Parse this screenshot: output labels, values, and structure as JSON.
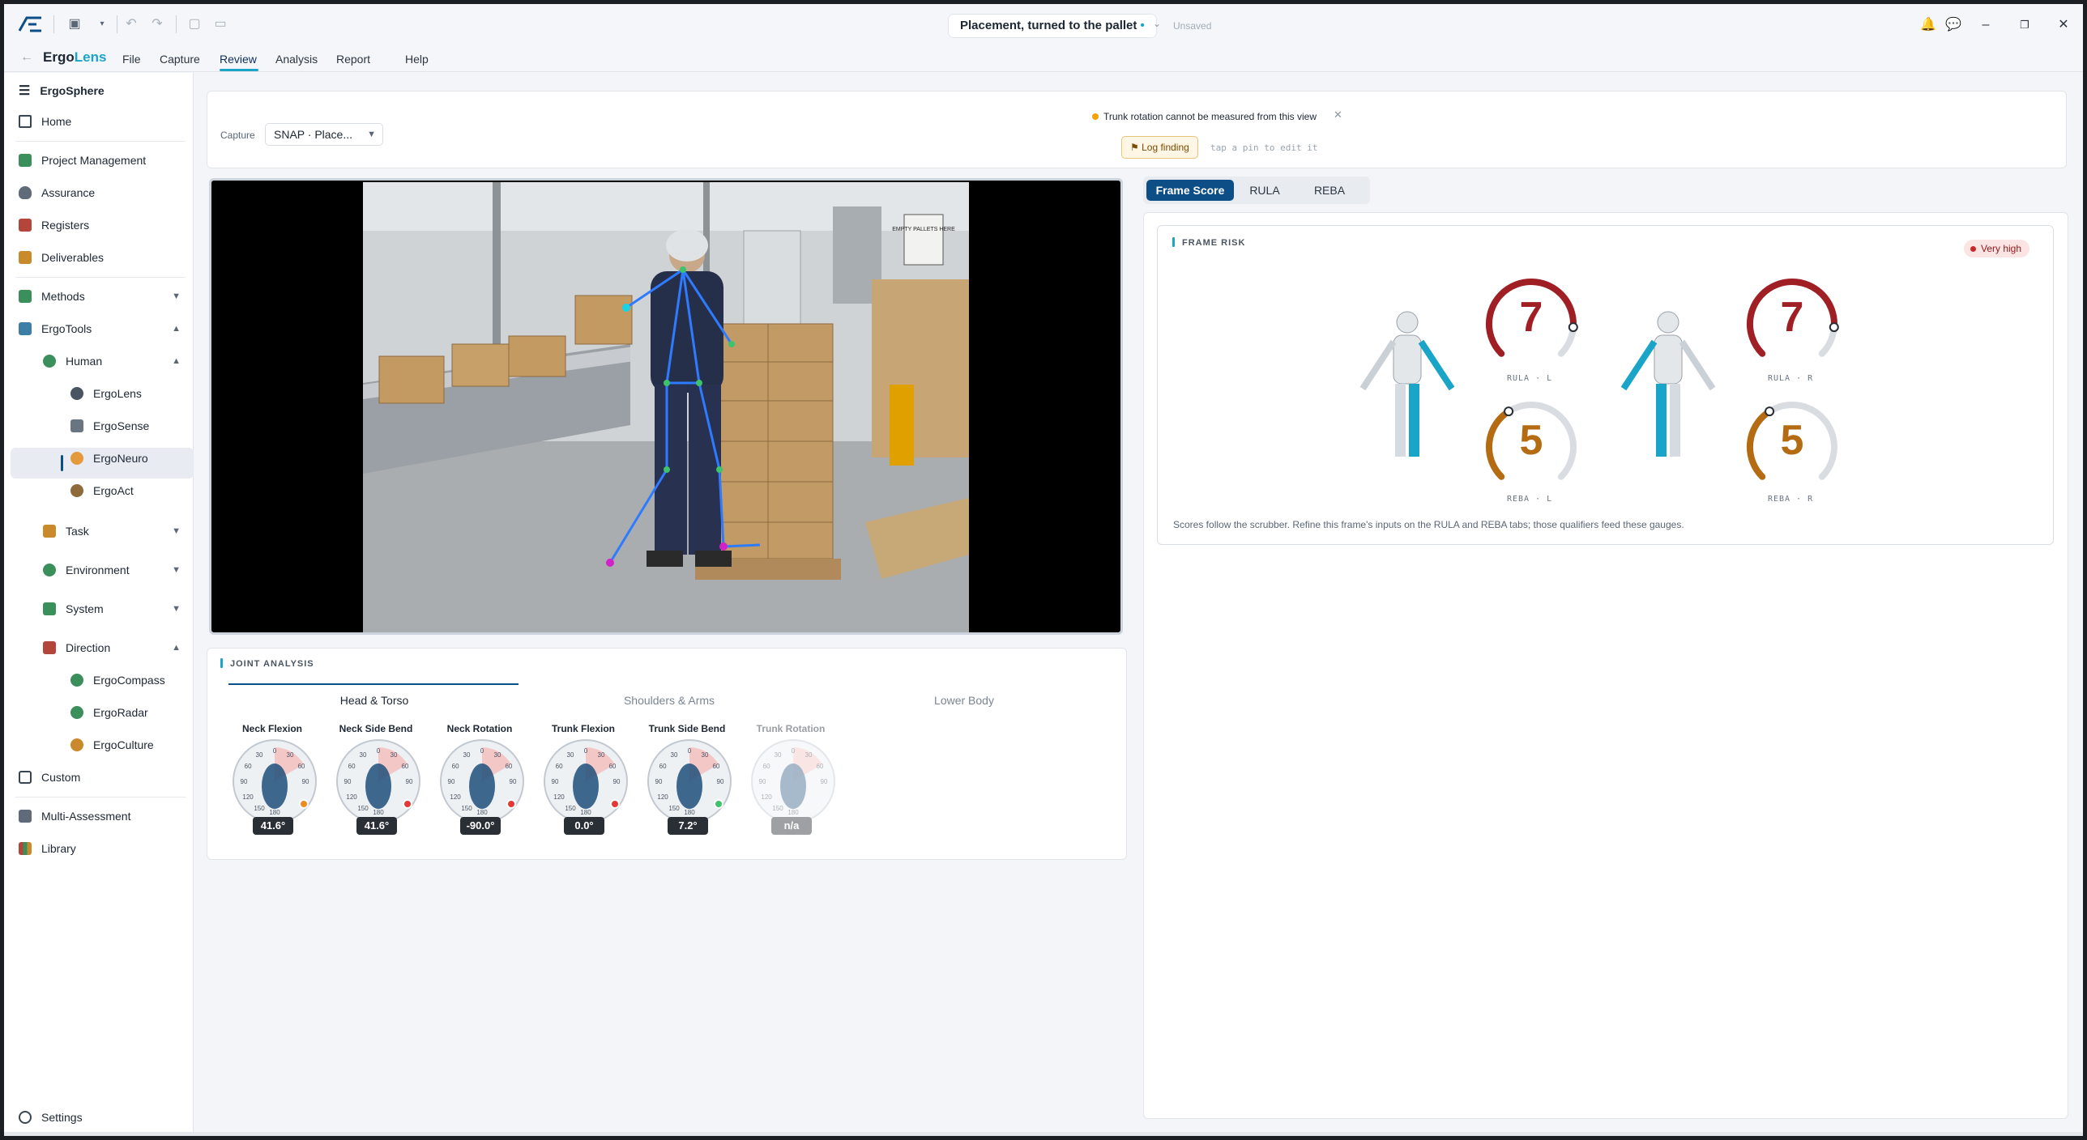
{
  "window": {
    "document_title": "Placement, turned to the pallet",
    "modified_dot": "•",
    "save_state": "Unsaved"
  },
  "menubar": {
    "brand_part1": "Ergo",
    "brand_part2": "Lens",
    "items": [
      "File",
      "Capture",
      "Review",
      "Analysis",
      "Report",
      "Help"
    ],
    "active": "Review"
  },
  "sidebar": {
    "header": "ErgoSphere",
    "items": [
      {
        "label": "Home"
      },
      {
        "label": "Project Management"
      },
      {
        "label": "Assurance"
      },
      {
        "label": "Registers"
      },
      {
        "label": "Deliverables"
      },
      {
        "label": "Methods"
      },
      {
        "label": "ErgoTools"
      },
      {
        "label": "Human"
      },
      {
        "label": "ErgoLens"
      },
      {
        "label": "ErgoSense"
      },
      {
        "label": "ErgoNeuro"
      },
      {
        "label": "ErgoAct"
      },
      {
        "label": "Task"
      },
      {
        "label": "Environment"
      },
      {
        "label": "System"
      },
      {
        "label": "Direction"
      },
      {
        "label": "ErgoCompass"
      },
      {
        "label": "ErgoRadar"
      },
      {
        "label": "ErgoCulture"
      },
      {
        "label": "Custom"
      },
      {
        "label": "Multi-Assessment"
      },
      {
        "label": "Library"
      }
    ],
    "settings": "Settings"
  },
  "capture": {
    "label": "Capture",
    "selected": "SNAP · Place...",
    "warning": "Trunk rotation cannot be measured from this view",
    "log_button": "⚑ Log finding",
    "hint": "tap a pin to edit it"
  },
  "video": {
    "sign_text": "EMPTY PALLETS HERE"
  },
  "joint_analysis": {
    "title": "JOINT ANALYSIS",
    "tabs": [
      "Head & Torso",
      "Shoulders & Arms",
      "Lower Body"
    ],
    "active_tab": "Head & Torso",
    "gauges": [
      {
        "label": "Neck Flexion",
        "value": "41.6°",
        "status_color": "#f08a1c"
      },
      {
        "label": "Neck Side Bend",
        "value": "41.6°",
        "status_color": "#e53935"
      },
      {
        "label": "Neck Rotation",
        "value": "-90.0°",
        "status_color": "#e53935"
      },
      {
        "label": "Trunk Flexion",
        "value": "0.0°",
        "status_color": "#e53935"
      },
      {
        "label": "Trunk Side Bend",
        "value": "7.2°",
        "status_color": "#3cc36b"
      },
      {
        "label": "Trunk Rotation",
        "value": "n/a",
        "status_color": ""
      }
    ],
    "dial_ticks": [
      "90",
      "60",
      "30",
      "0",
      "30",
      "60",
      "90",
      "120",
      "150",
      "180"
    ]
  },
  "score_tabs": {
    "items": [
      "Frame Score",
      "RULA",
      "REBA"
    ],
    "active": "Frame Score"
  },
  "frame_risk": {
    "title": "FRAME RISK",
    "badge": "Very high",
    "badge_color": "#c62828",
    "rula_color": "#a01f24",
    "reba_color": "#b46b12",
    "sides": [
      {
        "rula_score": "7",
        "rula_label": "RULA · L",
        "rula_fraction": 0.85,
        "reba_score": "5",
        "reba_label": "REBA · L",
        "reba_fraction": 0.38
      },
      {
        "rula_score": "7",
        "rula_label": "RULA · R",
        "rula_fraction": 0.85,
        "reba_score": "5",
        "reba_label": "REBA · R",
        "reba_fraction": 0.38
      }
    ],
    "note": "Scores follow the scrubber. Refine this frame's inputs on the RULA and REBA tabs; those qualifiers feed these gauges."
  }
}
